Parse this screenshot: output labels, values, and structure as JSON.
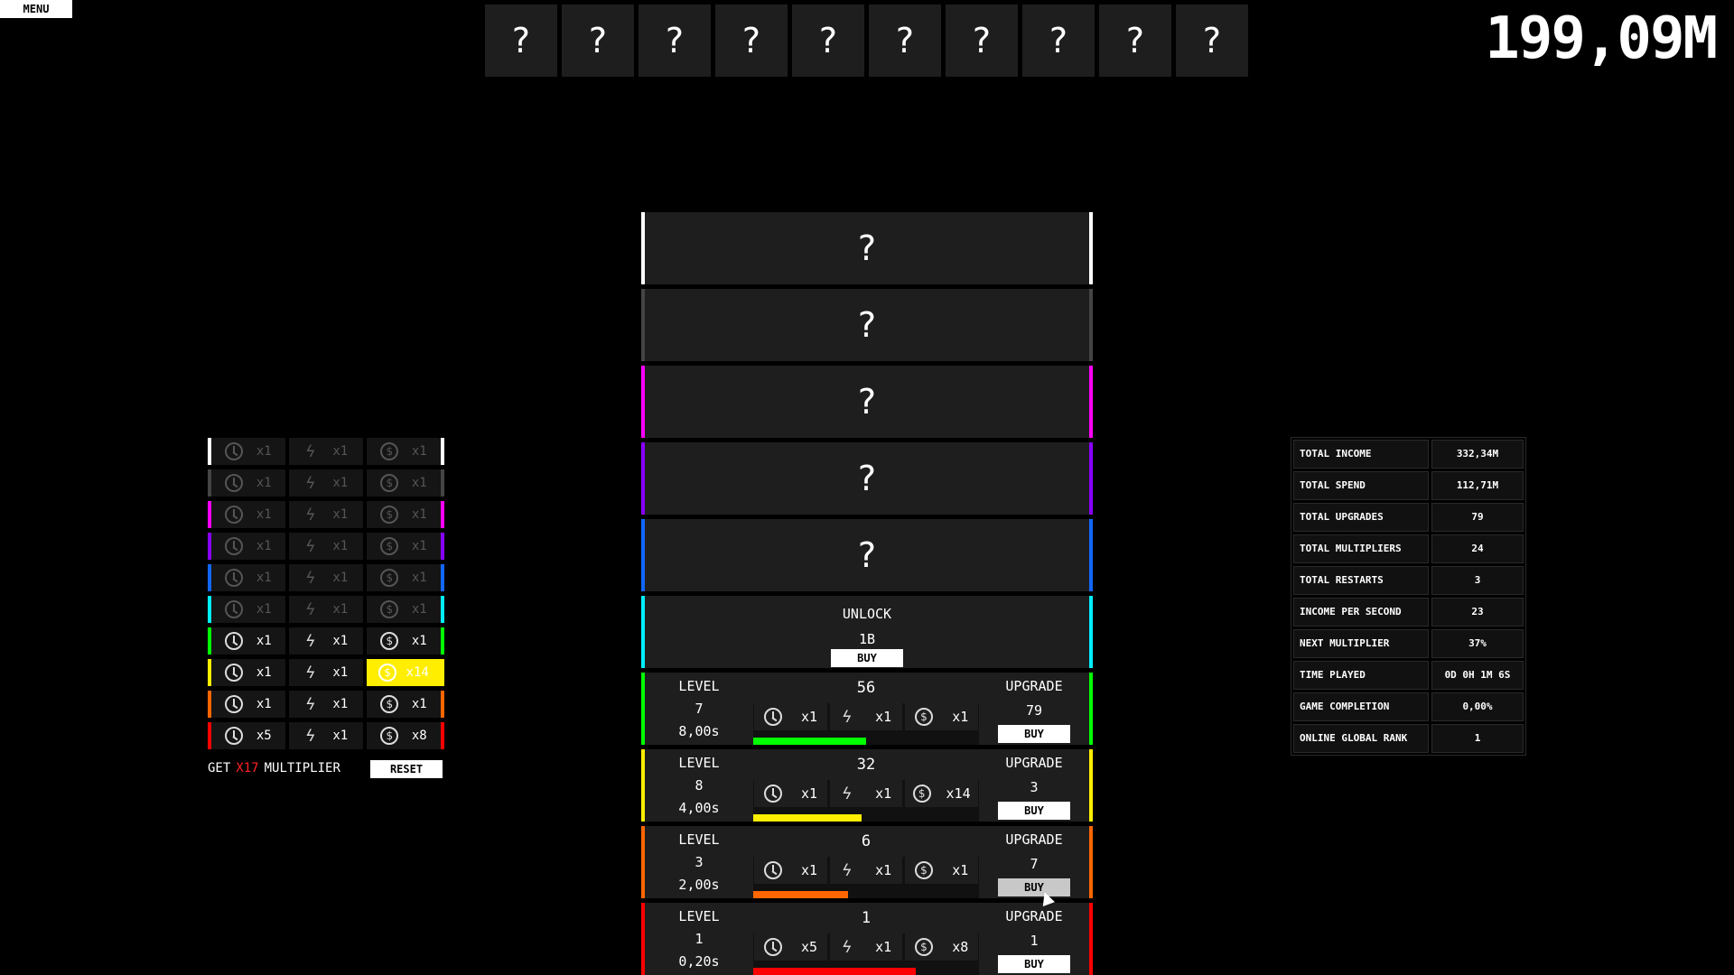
{
  "menu": {
    "label": "MENU"
  },
  "money": "199,09M",
  "slots": [
    "?",
    "?",
    "?",
    "?",
    "?",
    "?",
    "?",
    "?",
    "?",
    "?"
  ],
  "generators_locked": [
    {
      "label": "?",
      "color": "#ffffff"
    },
    {
      "label": "?",
      "color": "#444444"
    },
    {
      "label": "?",
      "color": "#ff00ff"
    },
    {
      "label": "?",
      "color": "#8800ff"
    },
    {
      "label": "?",
      "color": "#1166ff"
    }
  ],
  "unlock": {
    "title": "UNLOCK",
    "cost": "1B",
    "buy_label": "BUY",
    "color": "#00eeff"
  },
  "generators_active": [
    {
      "color": "#00ff00",
      "level_label": "LEVEL",
      "level": "7",
      "time": "8,00s",
      "count": "56",
      "clock": "x1",
      "bolt": "x1",
      "coin": "x1",
      "upgrade_label": "UPGRADE",
      "upgrade_cost": "79",
      "buy_label": "BUY",
      "progress": 0.5
    },
    {
      "color": "#ffee00",
      "level_label": "LEVEL",
      "level": "8",
      "time": "4,00s",
      "count": "32",
      "clock": "x1",
      "bolt": "x1",
      "coin": "x14",
      "upgrade_label": "UPGRADE",
      "upgrade_cost": "3",
      "buy_label": "BUY",
      "progress": 0.48
    },
    {
      "color": "#ff6600",
      "level_label": "LEVEL",
      "level": "3",
      "time": "2,00s",
      "count": "6",
      "clock": "x1",
      "bolt": "x1",
      "coin": "x1",
      "upgrade_label": "UPGRADE",
      "upgrade_cost": "7",
      "buy_label": "BUY",
      "progress": 0.42
    },
    {
      "color": "#ff0000",
      "level_label": "LEVEL",
      "level": "1",
      "time": "0,20s",
      "count": "1",
      "clock": "x5",
      "bolt": "x1",
      "coin": "x8",
      "upgrade_label": "UPGRADE",
      "upgrade_cost": "1",
      "buy_label": "BUY",
      "progress": 0.72
    }
  ],
  "multipliers": [
    {
      "color": "#ffffff",
      "clock": "x1",
      "bolt": "x1",
      "coin": "x1",
      "dim": true
    },
    {
      "color": "#444444",
      "clock": "x1",
      "bolt": "x1",
      "coin": "x1",
      "dim": true
    },
    {
      "color": "#ff00ff",
      "clock": "x1",
      "bolt": "x1",
      "coin": "x1",
      "dim": true
    },
    {
      "color": "#8800ff",
      "clock": "x1",
      "bolt": "x1",
      "coin": "x1",
      "dim": true
    },
    {
      "color": "#1166ff",
      "clock": "x1",
      "bolt": "x1",
      "coin": "x1",
      "dim": true
    },
    {
      "color": "#00eeff",
      "clock": "x1",
      "bolt": "x1",
      "coin": "x1",
      "dim": true
    },
    {
      "color": "#00ff00",
      "clock": "x1",
      "bolt": "x1",
      "coin": "x1",
      "dim": false
    },
    {
      "color": "#ffee00",
      "clock": "x1",
      "bolt": "x1",
      "coin": "x14",
      "dim": false,
      "coin_highlight": true
    },
    {
      "color": "#ff6600",
      "clock": "x1",
      "bolt": "x1",
      "coin": "x1",
      "dim": false
    },
    {
      "color": "#ff0000",
      "clock": "x5",
      "bolt": "x1",
      "coin": "x8",
      "dim": false
    }
  ],
  "prestige": {
    "get": "GET",
    "amount": "X17",
    "multiplier": "MULTIPLIER",
    "reset_label": "RESET"
  },
  "stats": [
    {
      "key": "TOTAL INCOME",
      "value": "332,34M"
    },
    {
      "key": "TOTAL SPEND",
      "value": "112,71M"
    },
    {
      "key": "TOTAL UPGRADES",
      "value": "79"
    },
    {
      "key": "TOTAL MULTIPLIERS",
      "value": "24"
    },
    {
      "key": "TOTAL RESTARTS",
      "value": "3"
    },
    {
      "key": "INCOME PER SECOND",
      "value": "23"
    },
    {
      "key": "NEXT MULTIPLIER",
      "value": "37%"
    },
    {
      "key": "TIME PLAYED",
      "value": "0D 0H 1M 6S"
    },
    {
      "key": "GAME COMPLETION",
      "value": "0,00%"
    },
    {
      "key": "ONLINE GLOBAL RANK",
      "value": "1"
    }
  ]
}
